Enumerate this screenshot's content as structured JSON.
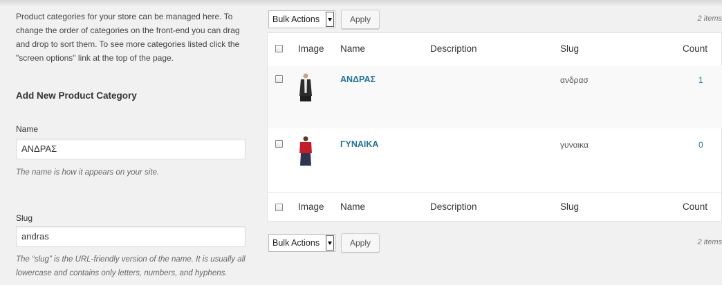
{
  "left": {
    "intro": "Product categories for your store can be managed here. To change the order of categories on the front-end you can drag and drop to sort them. To see more categories listed click the \"screen options\" link at the top of the page.",
    "add_title": "Add New Product Category",
    "name_label": "Name",
    "name_value": "ΑΝΔΡΑΣ",
    "name_desc": "The name is how it appears on your site.",
    "slug_label": "Slug",
    "slug_value": "andras",
    "slug_desc": "The “slug” is the URL-friendly version of the name. It is usually all lowercase and contains only letters, numbers, and hyphens."
  },
  "toolbar": {
    "bulk_label": "Bulk Actions",
    "apply_label": "Apply",
    "items_count": "2 items"
  },
  "table": {
    "columns": [
      "Image",
      "Name",
      "Description",
      "Slug",
      "Count"
    ],
    "rows": [
      {
        "name": "ΑΝΔΡΑΣ",
        "slug": "ανδρασ",
        "count": "1",
        "image": "man-vest-thumbnail"
      },
      {
        "name": "ΓΥΝΑΙΚΑ",
        "slug": "γυναικα",
        "count": "0",
        "image": "woman-red-top-thumbnail"
      }
    ]
  },
  "colors": {
    "link": "#21759b",
    "background": "#f1f1f1"
  }
}
